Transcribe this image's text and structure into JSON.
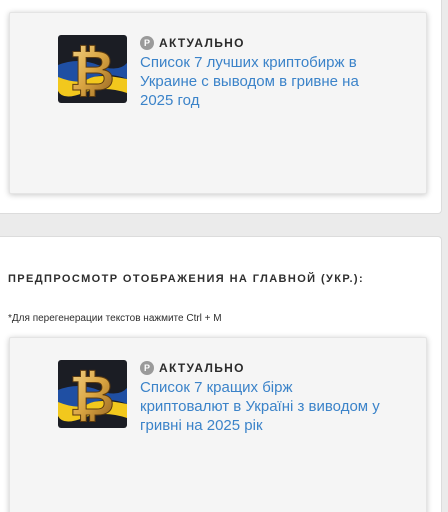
{
  "preview_ru": {
    "badge_letter": "P",
    "badge_label": "АКТУАЛЬНО",
    "headline": "Список 7 лучших криптобирж в Украине с выводом в гривне на 2025 год"
  },
  "section": {
    "title": "ПРЕДПРОСМОТР ОТОБРАЖЕНИЯ НА ГЛАВНОЙ (УКР.):",
    "hint": "*Для перегенерации текстов нажмите Ctrl + M"
  },
  "preview_uk": {
    "badge_letter": "P",
    "badge_label": "АКТУАЛЬНО",
    "headline": "Список 7 кращих бірж криптовалют в Україні з виводом у гривні на 2025 рік"
  },
  "thumbnail": {
    "icon": "bitcoin-on-ukrainian-flag",
    "flag_blue": "#1f4fa3",
    "flag_yellow": "#f2c81d",
    "coin_gold": "#d9a441"
  },
  "colors": {
    "link": "#3b83c9",
    "background": "#ebebeb",
    "card": "#f5f5f5"
  }
}
